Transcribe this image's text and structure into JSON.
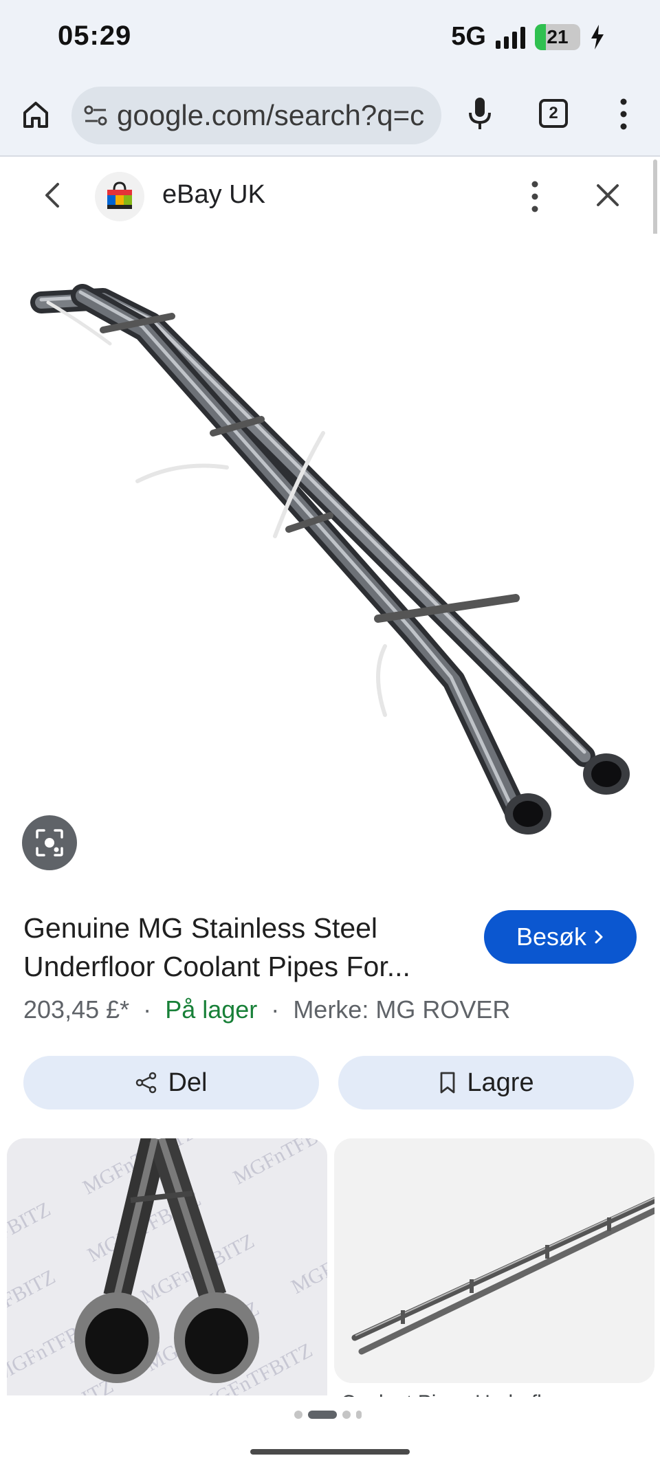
{
  "status_bar": {
    "time": "05:29",
    "network": "5G",
    "battery": "21"
  },
  "browser": {
    "url": "google.com/search?q=c",
    "tab_count": "2",
    "icons": [
      "home-icon",
      "tune-icon",
      "mic-icon",
      "tabs-icon",
      "more-vert-icon"
    ]
  },
  "sheet": {
    "site_name": "eBay UK",
    "icons": [
      "back-icon",
      "ebay-bag-icon",
      "more-vert-icon",
      "close-icon",
      "lens-icon"
    ]
  },
  "product": {
    "title": "Genuine MG Stainless Steel Underfloor Coolant Pipes For...",
    "price": "203,45 £*",
    "stock": "På lager",
    "brand": "Merke: MG ROVER",
    "separator": "·",
    "visit_label": "Besøk",
    "share_label": "Del",
    "save_label": "Lagre"
  },
  "related": {
    "watermark": "MGFnTFBITZ",
    "caption_partial": "Coolant Pipes Underfloor"
  },
  "pager": {
    "pages": 4,
    "active": 1
  },
  "colors": {
    "accent": "#0b57d0",
    "stock_green": "#188038",
    "chip_bg": "#e3ebf8",
    "chrome_bg": "#eef2f8"
  }
}
